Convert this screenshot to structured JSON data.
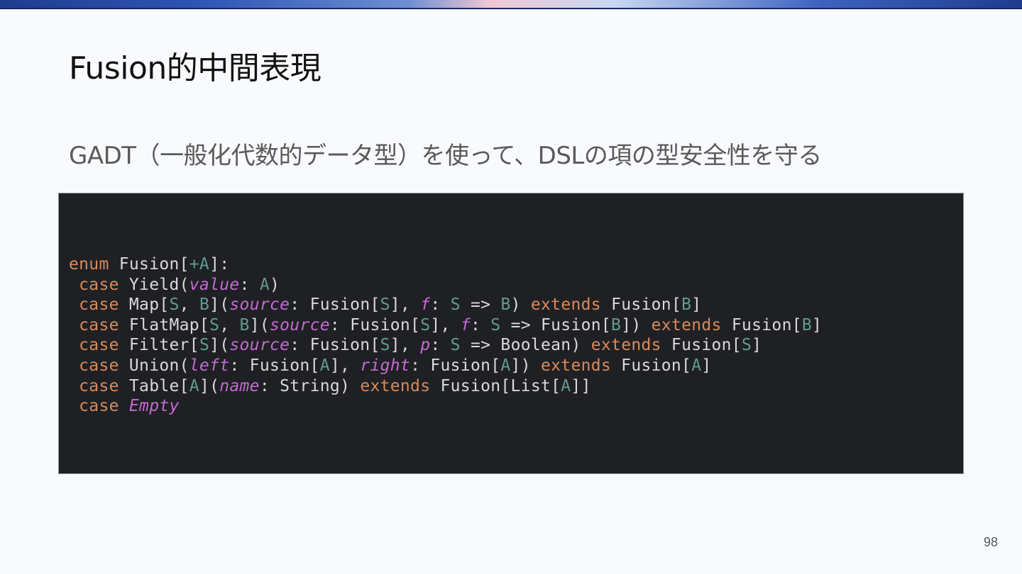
{
  "slide": {
    "title": "Fusion的中間表現",
    "subtitle": "GADT（一般化代数的データ型）を使って、DSLの項の型安全性を守る",
    "page_number": "98"
  },
  "colors": {
    "code_background": "#1f2024",
    "keyword": "#d98a59",
    "type_param": "#5f9b91",
    "param_name": "#c46ad2",
    "plain_code": "#d9d9d9"
  },
  "code_lines": [
    [
      {
        "t": "enum",
        "c": "kw"
      },
      {
        "t": " Fusion[",
        "c": "pl"
      },
      {
        "t": "+A",
        "c": "tp"
      },
      {
        "t": "]:",
        "c": "pl"
      }
    ],
    [
      {
        "t": " ",
        "c": "pl"
      },
      {
        "t": "case",
        "c": "kw"
      },
      {
        "t": " Yield(",
        "c": "pl"
      },
      {
        "t": "value",
        "c": "pm"
      },
      {
        "t": ": ",
        "c": "pl"
      },
      {
        "t": "A",
        "c": "tp"
      },
      {
        "t": ")",
        "c": "pl"
      }
    ],
    [
      {
        "t": " ",
        "c": "pl"
      },
      {
        "t": "case",
        "c": "kw"
      },
      {
        "t": " Map[",
        "c": "pl"
      },
      {
        "t": "S",
        "c": "tp"
      },
      {
        "t": ", ",
        "c": "pl"
      },
      {
        "t": "B",
        "c": "tp"
      },
      {
        "t": "](",
        "c": "pl"
      },
      {
        "t": "source",
        "c": "pm"
      },
      {
        "t": ": Fusion[",
        "c": "pl"
      },
      {
        "t": "S",
        "c": "tp"
      },
      {
        "t": "], ",
        "c": "pl"
      },
      {
        "t": "f",
        "c": "pm"
      },
      {
        "t": ": ",
        "c": "pl"
      },
      {
        "t": "S",
        "c": "tp"
      },
      {
        "t": " => ",
        "c": "pl"
      },
      {
        "t": "B",
        "c": "tp"
      },
      {
        "t": ") ",
        "c": "pl"
      },
      {
        "t": "extends",
        "c": "kw"
      },
      {
        "t": " Fusion[",
        "c": "pl"
      },
      {
        "t": "B",
        "c": "tp"
      },
      {
        "t": "]",
        "c": "pl"
      }
    ],
    [
      {
        "t": " ",
        "c": "pl"
      },
      {
        "t": "case",
        "c": "kw"
      },
      {
        "t": " FlatMap[",
        "c": "pl"
      },
      {
        "t": "S",
        "c": "tp"
      },
      {
        "t": ", ",
        "c": "pl"
      },
      {
        "t": "B",
        "c": "tp"
      },
      {
        "t": "](",
        "c": "pl"
      },
      {
        "t": "source",
        "c": "pm"
      },
      {
        "t": ": Fusion[",
        "c": "pl"
      },
      {
        "t": "S",
        "c": "tp"
      },
      {
        "t": "], ",
        "c": "pl"
      },
      {
        "t": "f",
        "c": "pm"
      },
      {
        "t": ": ",
        "c": "pl"
      },
      {
        "t": "S",
        "c": "tp"
      },
      {
        "t": " => Fusion[",
        "c": "pl"
      },
      {
        "t": "B",
        "c": "tp"
      },
      {
        "t": "]) ",
        "c": "pl"
      },
      {
        "t": "extends",
        "c": "kw"
      },
      {
        "t": " Fusion[",
        "c": "pl"
      },
      {
        "t": "B",
        "c": "tp"
      },
      {
        "t": "]",
        "c": "pl"
      }
    ],
    [
      {
        "t": " ",
        "c": "pl"
      },
      {
        "t": "case",
        "c": "kw"
      },
      {
        "t": " Filter[",
        "c": "pl"
      },
      {
        "t": "S",
        "c": "tp"
      },
      {
        "t": "](",
        "c": "pl"
      },
      {
        "t": "source",
        "c": "pm"
      },
      {
        "t": ": Fusion[",
        "c": "pl"
      },
      {
        "t": "S",
        "c": "tp"
      },
      {
        "t": "], ",
        "c": "pl"
      },
      {
        "t": "p",
        "c": "pm"
      },
      {
        "t": ": ",
        "c": "pl"
      },
      {
        "t": "S",
        "c": "tp"
      },
      {
        "t": " => Boolean) ",
        "c": "pl"
      },
      {
        "t": "extends",
        "c": "kw"
      },
      {
        "t": " Fusion[",
        "c": "pl"
      },
      {
        "t": "S",
        "c": "tp"
      },
      {
        "t": "]",
        "c": "pl"
      }
    ],
    [
      {
        "t": " ",
        "c": "pl"
      },
      {
        "t": "case",
        "c": "kw"
      },
      {
        "t": " Union(",
        "c": "pl"
      },
      {
        "t": "left",
        "c": "pm"
      },
      {
        "t": ": Fusion[",
        "c": "pl"
      },
      {
        "t": "A",
        "c": "tp"
      },
      {
        "t": "], ",
        "c": "pl"
      },
      {
        "t": "right",
        "c": "pm"
      },
      {
        "t": ": Fusion[",
        "c": "pl"
      },
      {
        "t": "A",
        "c": "tp"
      },
      {
        "t": "]) ",
        "c": "pl"
      },
      {
        "t": "extends",
        "c": "kw"
      },
      {
        "t": " Fusion[",
        "c": "pl"
      },
      {
        "t": "A",
        "c": "tp"
      },
      {
        "t": "]",
        "c": "pl"
      }
    ],
    [
      {
        "t": " ",
        "c": "pl"
      },
      {
        "t": "case",
        "c": "kw"
      },
      {
        "t": " Table[",
        "c": "pl"
      },
      {
        "t": "A",
        "c": "tp"
      },
      {
        "t": "](",
        "c": "pl"
      },
      {
        "t": "name",
        "c": "pm"
      },
      {
        "t": ": String) ",
        "c": "pl"
      },
      {
        "t": "extends",
        "c": "kw"
      },
      {
        "t": " Fusion[List[",
        "c": "pl"
      },
      {
        "t": "A",
        "c": "tp"
      },
      {
        "t": "]]",
        "c": "pl"
      }
    ],
    [
      {
        "t": " ",
        "c": "pl"
      },
      {
        "t": "case",
        "c": "kw"
      },
      {
        "t": " ",
        "c": "pl"
      },
      {
        "t": "Empty",
        "c": "pm"
      }
    ]
  ]
}
